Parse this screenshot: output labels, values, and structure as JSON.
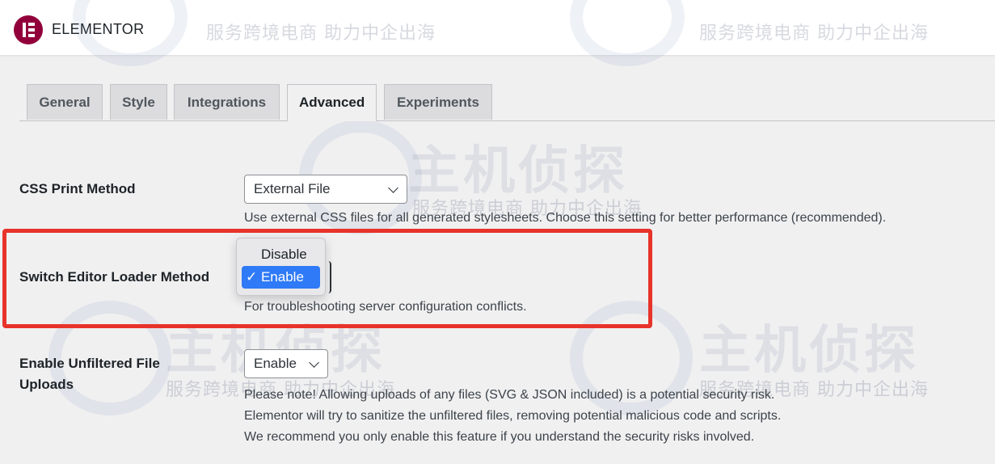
{
  "header": {
    "brand_name": "ELEMENTOR",
    "brand_color": "#92003b"
  },
  "tabs": [
    {
      "label": "General",
      "active": false
    },
    {
      "label": "Style",
      "active": false
    },
    {
      "label": "Integrations",
      "active": false
    },
    {
      "label": "Advanced",
      "active": true
    },
    {
      "label": "Experiments",
      "active": false
    }
  ],
  "settings": {
    "css_print_method": {
      "label": "CSS Print Method",
      "value": "External File",
      "description": "Use external CSS files for all generated stylesheets. Choose this setting for better performance (recommended)."
    },
    "switch_editor_loader": {
      "label": "Switch Editor Loader Method",
      "options": [
        "Disable",
        "Enable"
      ],
      "selected_display": "✓ Enable",
      "description": "For troubleshooting server configuration conflicts."
    },
    "unfiltered_uploads": {
      "label_line1": "Enable Unfiltered File",
      "label_line2": "Uploads",
      "value": "Enable",
      "description_lines": [
        "Please note! Allowing uploads of any files (SVG & JSON included) is a potential security risk.",
        "Elementor will try to sanitize the unfiltered files, removing potential malicious code and scripts.",
        "We recommend you only enable this feature if you understand the security risks involved."
      ]
    }
  },
  "watermark": {
    "tagline": "服务跨境电商 助力中企出海",
    "brand": "主机侦探"
  },
  "colors": {
    "highlight": "#e8332a",
    "selected_option": "#2f7af6"
  }
}
